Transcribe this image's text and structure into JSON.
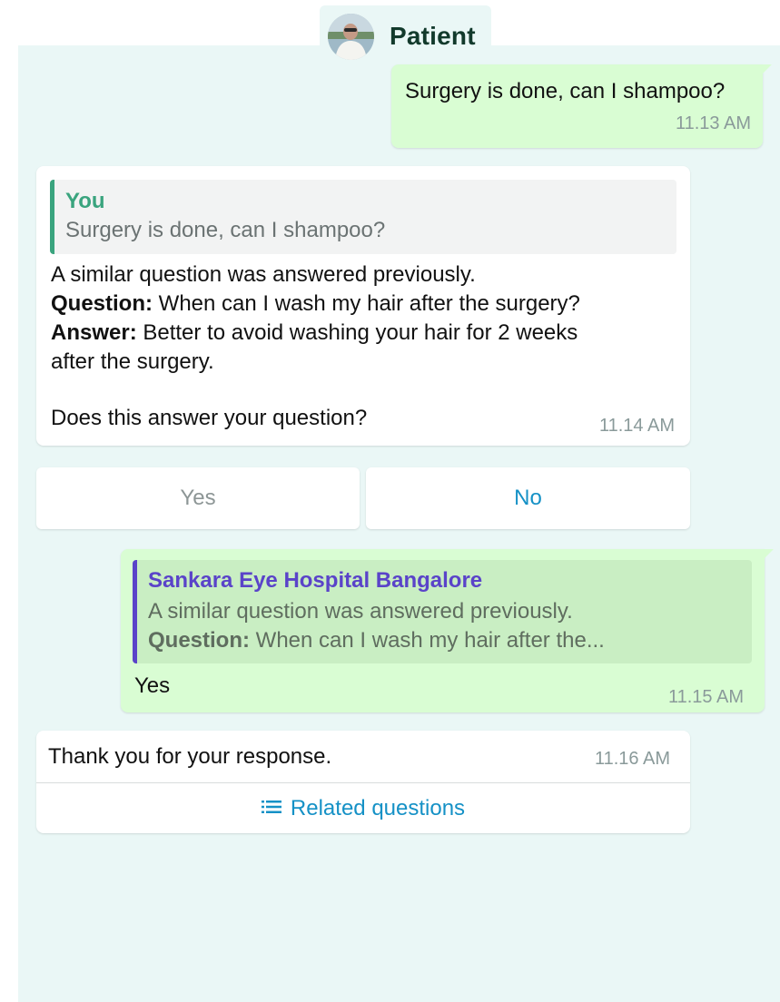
{
  "header": {
    "title": "Patient",
    "avatar_icon": "patient-avatar"
  },
  "messages": {
    "m1": {
      "text": "Surgery is done, can I shampoo?",
      "time": "11.13 AM"
    },
    "m2": {
      "quote_sender": "You",
      "quote_text": "Surgery is done, can I shampoo?",
      "intro": "A similar question was answered previously.",
      "question_label": "Question:",
      "question_text": "When can I wash my hair after the surgery?",
      "answer_label": "Answer:",
      "answer_text_line1": "Better to avoid washing your hair for 2 weeks",
      "answer_text_line2": "after the surgery.",
      "prompt": "Does this answer your question?",
      "time": "11.14 AM"
    },
    "quick_replies": {
      "yes": "Yes",
      "no": "No"
    },
    "m3": {
      "quote_sender": "Sankara Eye Hospital Bangalore",
      "quote_line1": "A similar question was answered previously.",
      "quote_label": "Question:",
      "quote_line2": "When can I wash my hair after the...",
      "text": "Yes",
      "time": "11.15 AM"
    },
    "m4": {
      "text": "Thank you for your response.",
      "time": "11.16 AM",
      "related_label": "Related questions",
      "related_icon": "list-icon"
    }
  },
  "colors": {
    "chat_background": "#eaf7f6",
    "outgoing_bubble": "#d9fdd3",
    "incoming_bubble": "#ffffff",
    "header_text": "#123a2c",
    "quote_you": "#3aa47e",
    "quote_hospital": "#5a43c9",
    "link_blue": "#1591c6",
    "timestamp": "#8a9a9a"
  }
}
